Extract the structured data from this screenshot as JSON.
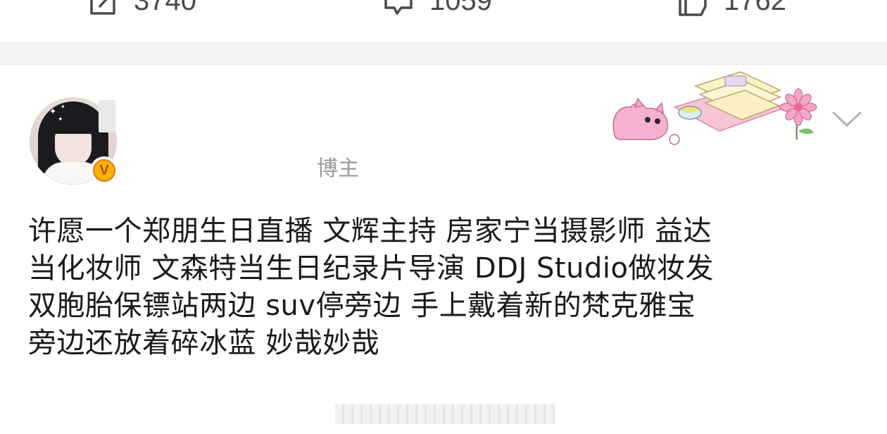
{
  "actions": {
    "repost": {
      "icon": "repost-icon",
      "count": "3740"
    },
    "comment": {
      "icon": "comment-icon",
      "count": "1059"
    },
    "like": {
      "icon": "like-icon",
      "count": "1762"
    }
  },
  "post": {
    "author": {
      "avatar": "avatar",
      "verified_badge": "V",
      "role": "博主"
    },
    "text_lines": [
      "许愿一个郑朋生日直播 文辉主持 房家宁当摄影师 益达",
      "当化妆师 文森特当生日纪录片导演 DDJ Studio做妆发",
      "双胞胎保镖站两边 suv停旁边 手上戴着新的梵克雅宝",
      "旁边还放着碎冰蓝 妙哉妙哉"
    ]
  },
  "colors": {
    "text": "#1a1a1a",
    "muted": "#9a9a9a",
    "separator": "#f2f2f2",
    "badge": "#f7b500"
  }
}
